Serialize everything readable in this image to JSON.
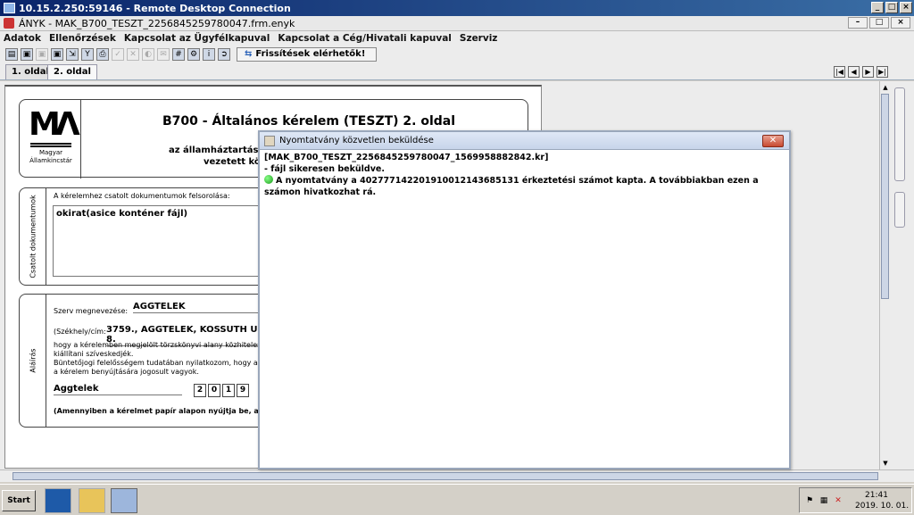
{
  "rdp": {
    "title": "10.15.2.250:59146 - Remote Desktop Connection"
  },
  "app": {
    "title": "ÁNYK - MAK_B700_TESZT_2256845259780047.frm.enyk"
  },
  "menu": [
    "Adatok",
    "Ellenőrzések",
    "Kapcsolat az Ügyfélkapuval",
    "Kapcsolat a Cég/Hivatali kapuval",
    "Szerviz"
  ],
  "toolbar": {
    "update_label": "Frissítések elérhetők!"
  },
  "tabs": [
    "1. oldal",
    "2. oldal"
  ],
  "form": {
    "title": "B700 - Általános kérelem (TESZT) 2. oldal",
    "header_line1": "az államháztartásról s",
    "header_line2": "vezetett közh",
    "logo_text1": "Magyar",
    "logo_text2": "Államkincstár",
    "docs_side_label": "Csatolt dokumentumok",
    "docs_list_label": "A kérelemhez csatolt dokumentumok felsorolása:",
    "docs_value": "okirat(asice konténer fájl)",
    "sign_side_label": "Aláírás",
    "org_label": "Szerv megnevezése:",
    "org_value": "AGGTELEK",
    "seat_label": "(Székhely/cím:",
    "seat_value": "3759., AGGTELEK, KOSSUTH U. 8.",
    "text1": "hogy a kérelemben megjelölt törzskönyvi alany közhiteles törzs",
    "text2": "kiállítani szíveskedjék.",
    "text3": "Büntetőjogi felelősségem tudatában nyilatkozom, hogy az általu",
    "text4": "a kérelem benyújtására jogosult vagyok.",
    "place_value": "Aggtelek",
    "year_digits": [
      "2",
      "0",
      "1",
      "9"
    ],
    "footer_note": "(Amennyiben a kérelmet papír alapon nyújtja be, aláírással"
  },
  "dialog": {
    "title": "Nyomtatvány közvetlen beküldése",
    "line1": "[MAK_B700_TESZT_2256845259780047_1569958882842.kr]",
    "line2": "- fájl sikeresen beküldve.",
    "line3": "A nyomtatvány a 402777142201910012143685131 érkeztetési számot kapta. A továbbiakban ezen a számon hivatkozhat rá."
  },
  "taskbar": {
    "start_label": "Start",
    "time": "21:41",
    "date": "2019. 10. 01."
  }
}
